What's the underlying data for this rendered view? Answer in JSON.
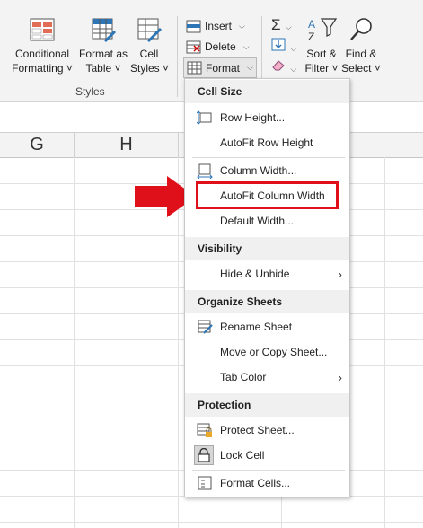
{
  "ribbon": {
    "styles_group": {
      "conditional_formatting": [
        "Conditional",
        "Formatting ˅"
      ],
      "format_as_table": [
        "Format as",
        "Table ˅"
      ],
      "cell_styles": [
        "Cell",
        "Styles ˅"
      ],
      "group_label": "Styles"
    },
    "cells_group": {
      "insert": "Insert",
      "delete": "Delete",
      "format": "Format"
    },
    "editing_group": {
      "sort_filter": [
        "Sort &",
        "Filter ˅"
      ],
      "find_select": [
        "Find &",
        "Select ˅"
      ]
    }
  },
  "sheet": {
    "columns": [
      "G",
      "H"
    ]
  },
  "menu": {
    "cell_size": {
      "heading": "Cell Size",
      "row_height": "Row Height...",
      "autofit_row_height": "AutoFit Row Height",
      "column_width": "Column Width...",
      "autofit_column_width": "AutoFit Column Width",
      "default_width": "Default Width..."
    },
    "visibility": {
      "heading": "Visibility",
      "hide_unhide": "Hide & Unhide"
    },
    "organize_sheets": {
      "heading": "Organize Sheets",
      "rename_sheet": "Rename Sheet",
      "move_copy_sheet": "Move or Copy Sheet...",
      "tab_color": "Tab Color"
    },
    "protection": {
      "heading": "Protection",
      "protect_sheet": "Protect Sheet...",
      "lock_cell": "Lock Cell",
      "format_cells": "Format Cells..."
    }
  },
  "colors": {
    "highlight": "#e0101a",
    "arrow": "#e0101a"
  },
  "icons": [
    "conditional-formatting-icon",
    "format-as-table-icon",
    "cell-styles-icon",
    "insert-icon",
    "delete-icon",
    "format-icon",
    "autosum-icon",
    "fill-icon",
    "clear-icon",
    "sort-filter-icon",
    "find-icon",
    "row-height-icon",
    "column-width-icon",
    "rename-sheet-icon",
    "protect-sheet-icon",
    "lock-icon",
    "format-cells-icon",
    "red-arrow-icon"
  ]
}
